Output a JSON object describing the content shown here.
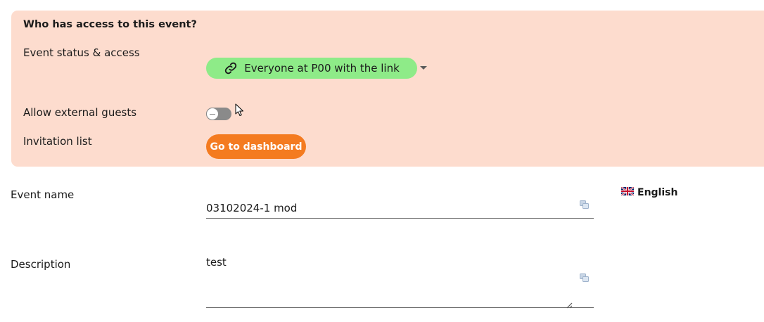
{
  "access": {
    "title": "Who has access to this event?",
    "status_label": "Event status & access",
    "status_value": "Everyone at P00 with the link",
    "external_guests_label": "Allow external guests",
    "external_guests_enabled": false,
    "invitation_label": "Invitation list",
    "dashboard_button": "Go to dashboard"
  },
  "form": {
    "event_name_label": "Event name",
    "event_name_value": "03102024-1 mod",
    "description_label": "Description",
    "description_value": "test"
  },
  "language": {
    "label": "English",
    "flag_icon": "uk-flag-icon"
  },
  "colors": {
    "panel_bg": "#fddcce",
    "status_pill": "#8eeb88",
    "dashboard_button": "#f47b20"
  }
}
